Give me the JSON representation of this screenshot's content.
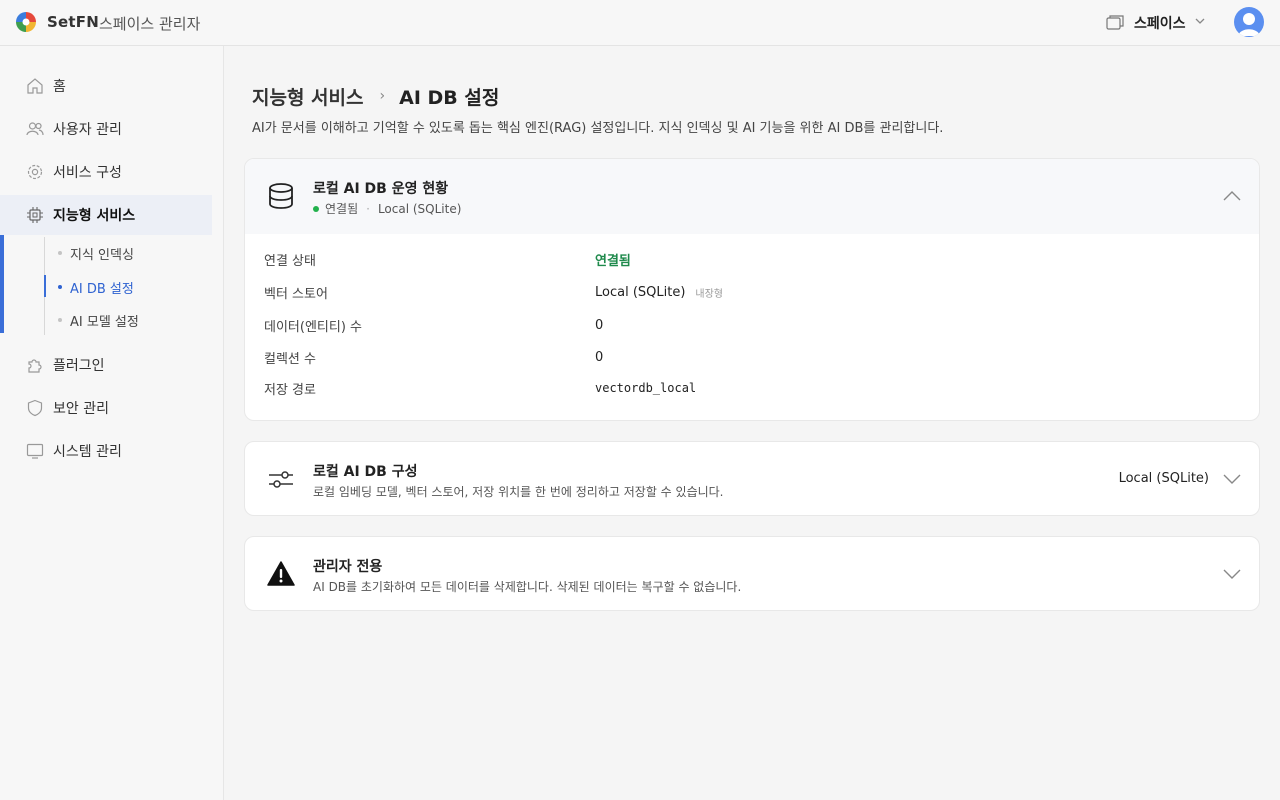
{
  "header": {
    "brand": "SetFN",
    "app_title": "스페이스 관리자",
    "space_label": "스페이스"
  },
  "sidebar": {
    "items": [
      {
        "label": "홈",
        "icon": "home-icon"
      },
      {
        "label": "사용자 관리",
        "icon": "users-icon"
      },
      {
        "label": "서비스 구성",
        "icon": "gear-icon"
      },
      {
        "label": "지능형 서비스",
        "icon": "chip-icon"
      },
      {
        "label": "플러그인",
        "icon": "puzzle-icon"
      },
      {
        "label": "보안 관리",
        "icon": "shield-icon"
      },
      {
        "label": "시스템 관리",
        "icon": "monitor-icon"
      }
    ],
    "sub_items": [
      {
        "label": "지식 인덱싱"
      },
      {
        "label": "AI DB 설정"
      },
      {
        "label": "AI 모델 설정"
      }
    ]
  },
  "page": {
    "breadcrumb_parent": "지능형 서비스",
    "breadcrumb_sep": "›",
    "breadcrumb_current": "AI DB 설정",
    "description": "AI가 문서를 이해하고 기억할 수 있도록 돕는 핵심 엔진(RAG) 설정입니다. 지식 인덱싱 및 AI 기능을 위한 AI DB를 관리합니다."
  },
  "status_card": {
    "title": "로컬 AI DB 운영 현황",
    "status": "연결됨",
    "sep": "·",
    "store": "Local (SQLite)",
    "rows": [
      {
        "key": "연결 상태",
        "value": "연결됨"
      },
      {
        "key": "벡터 스토어",
        "value": "Local (SQLite)",
        "badge": "내장형"
      },
      {
        "key": "데이터(엔티티) 수",
        "value": "0"
      },
      {
        "key": "컬렉션 수",
        "value": "0"
      },
      {
        "key": "저장 경로",
        "value": "vectordb_local"
      }
    ]
  },
  "config_card": {
    "title": "로컬 AI DB 구성",
    "subtitle": "로컬 임베딩 모델, 벡터 스토어, 저장 위치를 한 번에 정리하고 저장할 수 있습니다.",
    "value": "Local (SQLite)"
  },
  "admin_card": {
    "title": "관리자 전용",
    "subtitle": "AI DB를 초기화하여 모든 데이터를 삭제합니다. 삭제된 데이터는 복구할 수 없습니다."
  },
  "colors": {
    "accent": "#3a6ed8",
    "ok": "#1f8a4c",
    "status_dot": "#22b14c"
  }
}
